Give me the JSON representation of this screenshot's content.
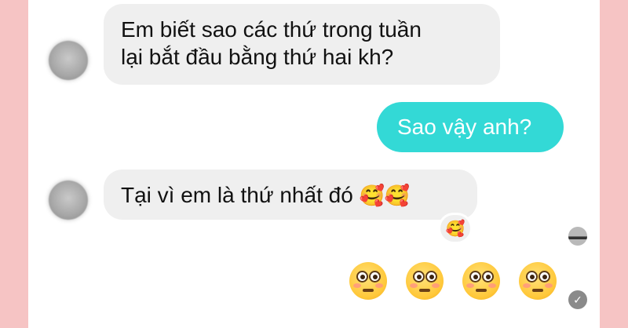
{
  "messages": {
    "first": {
      "line1": "Em biết sao các thứ trong tuần",
      "line2": "lại bắt đầu bằng thứ hai kh?"
    },
    "reply": "Sao vậy anh?",
    "second": {
      "text": "Tại vì em là thứ nhất đó",
      "emoji": "🥰🥰"
    },
    "reaction": "🥰",
    "final_emojis": [
      "😳",
      "😳",
      "😳",
      "😳"
    ]
  },
  "status": {
    "sent_icon": "check-icon"
  },
  "colors": {
    "background_sides": "#f6c4c4",
    "incoming_bubble": "#efefef",
    "outgoing_bubble": "#33d9d6"
  }
}
